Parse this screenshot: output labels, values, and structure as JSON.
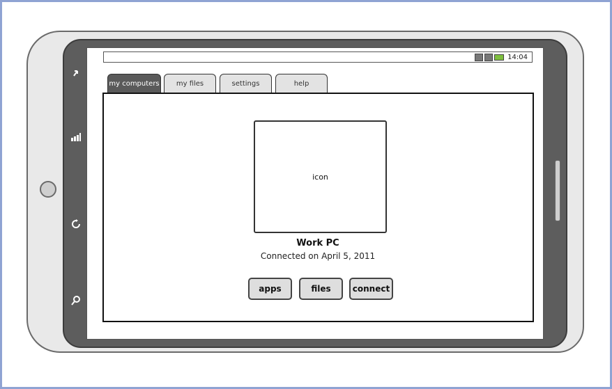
{
  "statusbar": {
    "clock": "14:04"
  },
  "device": {
    "nav_icons": [
      "back-arrow-icon",
      "signal-bars-icon",
      "refresh-icon",
      "search-icon"
    ]
  },
  "tabs": [
    {
      "label": "my computers",
      "active": true
    },
    {
      "label": "my files",
      "active": false
    },
    {
      "label": "settings",
      "active": false
    },
    {
      "label": "help",
      "active": false
    }
  ],
  "computer": {
    "icon_placeholder": "icon",
    "name": "Work PC",
    "status": "Connected on April 5, 2011"
  },
  "actions": {
    "apps_label": "apps",
    "files_label": "files",
    "connect_label": "connect"
  },
  "colors": {
    "frame": "#8fa3d3",
    "device_dark": "#5d5d5d",
    "active_tab": "#5a5a5a",
    "battery": "#7fbf3f"
  }
}
